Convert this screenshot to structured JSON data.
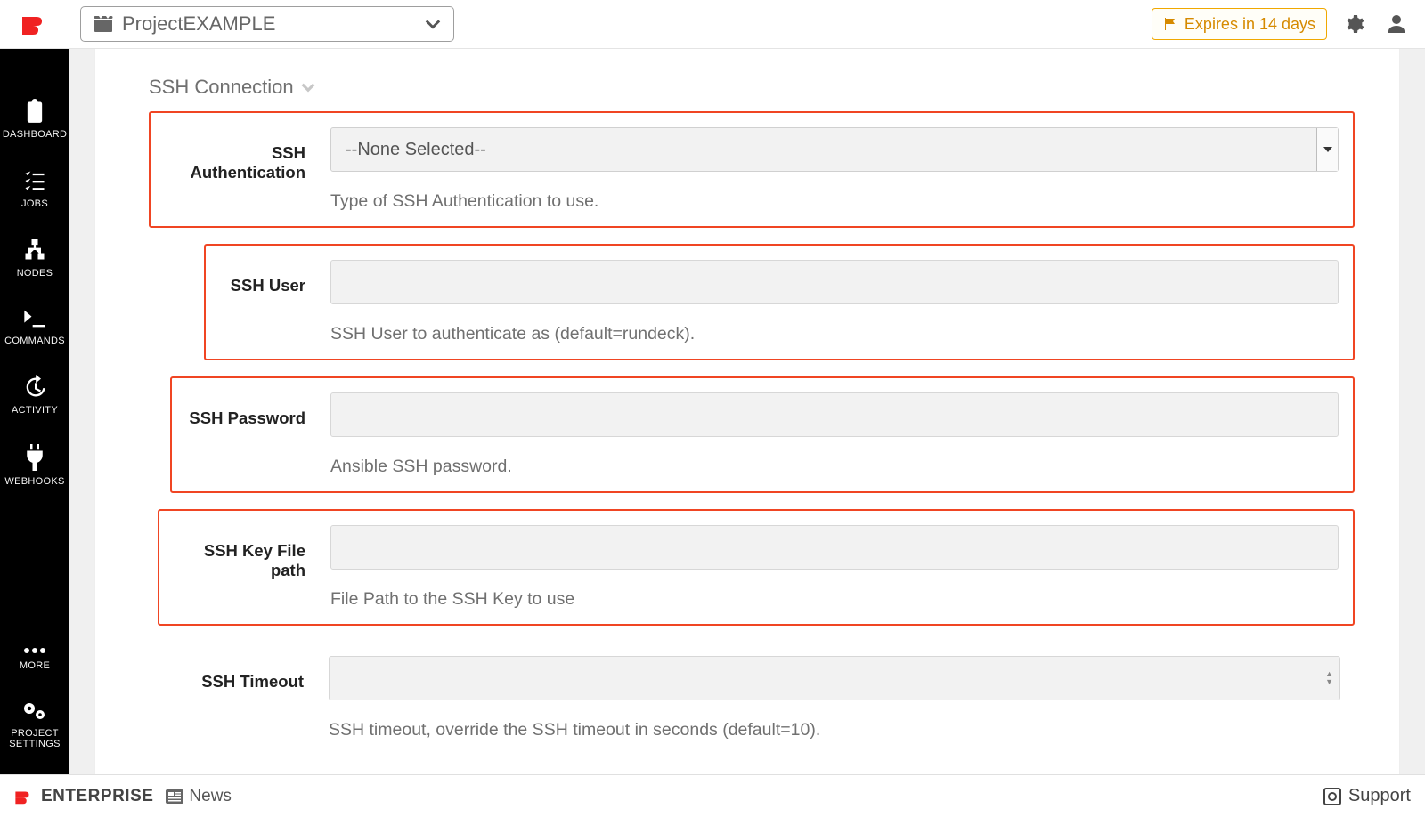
{
  "topbar": {
    "project_name": "ProjectEXAMPLE",
    "license_banner": "Expires in 14 days"
  },
  "sidebar": {
    "items": [
      {
        "id": "dashboard",
        "label": "DASHBOARD"
      },
      {
        "id": "jobs",
        "label": "JOBS"
      },
      {
        "id": "nodes",
        "label": "NODES"
      },
      {
        "id": "commands",
        "label": "COMMANDS"
      },
      {
        "id": "activity",
        "label": "ACTIVITY"
      },
      {
        "id": "webhooks",
        "label": "WEBHOOKS"
      },
      {
        "id": "more",
        "label": "MORE"
      },
      {
        "id": "settings",
        "label": "PROJECT SETTINGS"
      }
    ]
  },
  "section": {
    "title": "SSH Connection"
  },
  "fields": {
    "ssh_auth": {
      "label": "SSH Authentication",
      "selected": "--None Selected--",
      "help": "Type of SSH Authentication to use."
    },
    "ssh_user": {
      "label": "SSH User",
      "value": "",
      "help": "SSH User to authenticate as (default=rundeck)."
    },
    "ssh_password": {
      "label": "SSH Password",
      "value": "",
      "help": "Ansible SSH password."
    },
    "ssh_key_path": {
      "label": "SSH Key File path",
      "value": "",
      "help": "File Path to the SSH Key to use"
    },
    "ssh_timeout": {
      "label": "SSH Timeout",
      "value": "",
      "help": "SSH timeout, override the SSH timeout in seconds (default=10)."
    }
  },
  "footer": {
    "brand": "ENTERPRISE",
    "news_label": "News",
    "support_label": "Support"
  },
  "colors": {
    "highlight_border": "#f04523",
    "warn_border": "#f0a800",
    "warn_text": "#d68a00"
  }
}
